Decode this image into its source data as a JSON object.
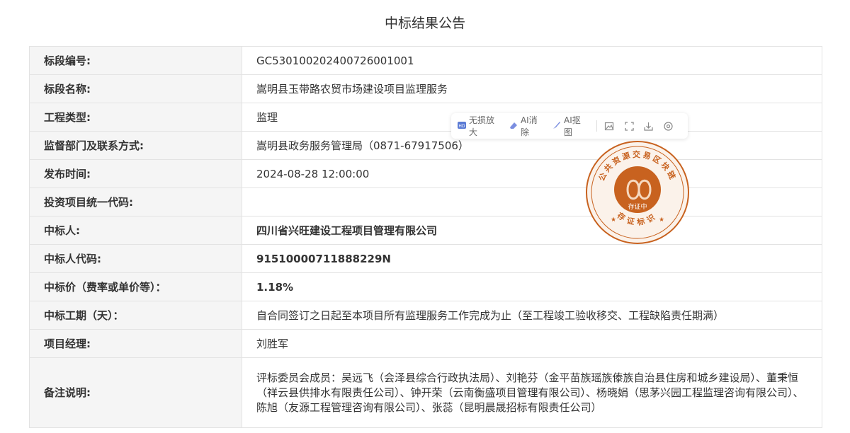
{
  "page": {
    "title": "中标结果公告"
  },
  "rows": [
    {
      "label": "标段编号:",
      "value": "GC5301002024007260010​01"
    },
    {
      "label": "标段名称:",
      "value": "嵩明县玉带路农贸市场建设项目监理服务"
    },
    {
      "label": "工程类型:",
      "value": "监理"
    },
    {
      "label": "监督部门及联系方式:",
      "value": "嵩明县政务服务管理局（0871-67917506）"
    },
    {
      "label": "发布时间:",
      "value": "2024-08-28 12:00:00"
    },
    {
      "label": "投资项目统一代码:",
      "value": ""
    },
    {
      "label": "中标人:",
      "value": "四川省兴旺建设工程项目管理有限公司"
    },
    {
      "label": "中标人代码:",
      "value": "91510000711888229N"
    },
    {
      "label": "中标价（费率或单价等）：",
      "value": "1.18%"
    },
    {
      "label": "中标工期（天）：",
      "value": "自合同签订之日起至本项目所有监理服务工作完成为止（至工程竣工验收移交、工程缺陷责任期满）"
    },
    {
      "label": "项目经理:",
      "value": "刘胜军"
    },
    {
      "label": "备注说明:",
      "value": "评标委员会成员：吴远飞（会泽县综合行政执法局）、刘艳芬（金平苗族瑶族傣族自治县住房和城乡建设局）、董秉恒（祥云县供排水有限责任公司）、钟开荣（云南衡盛项目管理有限公司）、杨晓娟（思茅兴园工程监理咨询有限公司）、陈旭（友源工程管理咨询有限公司）、张蕊（昆明晨晟招标有限责任公司）"
    }
  ],
  "toolbar": {
    "lossless_zoom": "无损放大",
    "ai_erase": "AI消除",
    "ai_cutout": "AI抠图",
    "icons": [
      "image-edit-icon",
      "crop-icon",
      "download-icon",
      "settings-icon"
    ]
  },
  "seal": {
    "top_text": "公共资源交易区块链",
    "center_text": "存证中",
    "bottom_text": "存证标识",
    "color": "#c8621f"
  }
}
